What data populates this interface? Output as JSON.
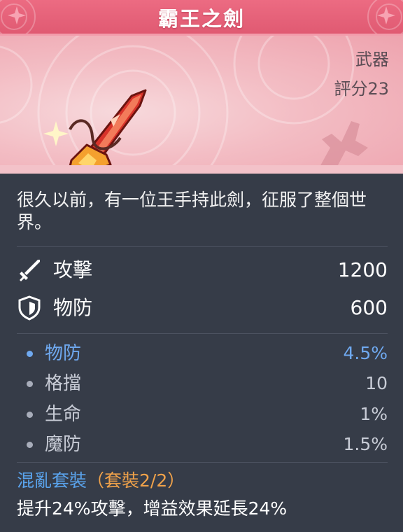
{
  "item": {
    "name": "霸王之劍",
    "type": "武器",
    "score": "評分23",
    "description": "很久以前，有一位王手持此劍，征服了整個世界。"
  },
  "main_stats": [
    {
      "icon": "sword-icon",
      "label": "攻擊",
      "value": "1200"
    },
    {
      "icon": "shield-icon",
      "label": "物防",
      "value": "600"
    }
  ],
  "sub_stats": [
    {
      "label": "物防",
      "value": "4.5%",
      "highlight": true
    },
    {
      "label": "格擋",
      "value": "10",
      "highlight": false
    },
    {
      "label": "生命",
      "value": "1%",
      "highlight": false
    },
    {
      "label": "魔防",
      "value": "1.5%",
      "highlight": false
    }
  ],
  "set": {
    "name": "混亂套裝",
    "count": "（套裝2/2）",
    "effect": "提升24%攻擊，增益效果延長24%"
  },
  "colors": {
    "title_bar": "#e05a72",
    "panel": "#363c48",
    "highlight_blue": "#6fa9f0",
    "set_orange": "#f0a24a"
  }
}
